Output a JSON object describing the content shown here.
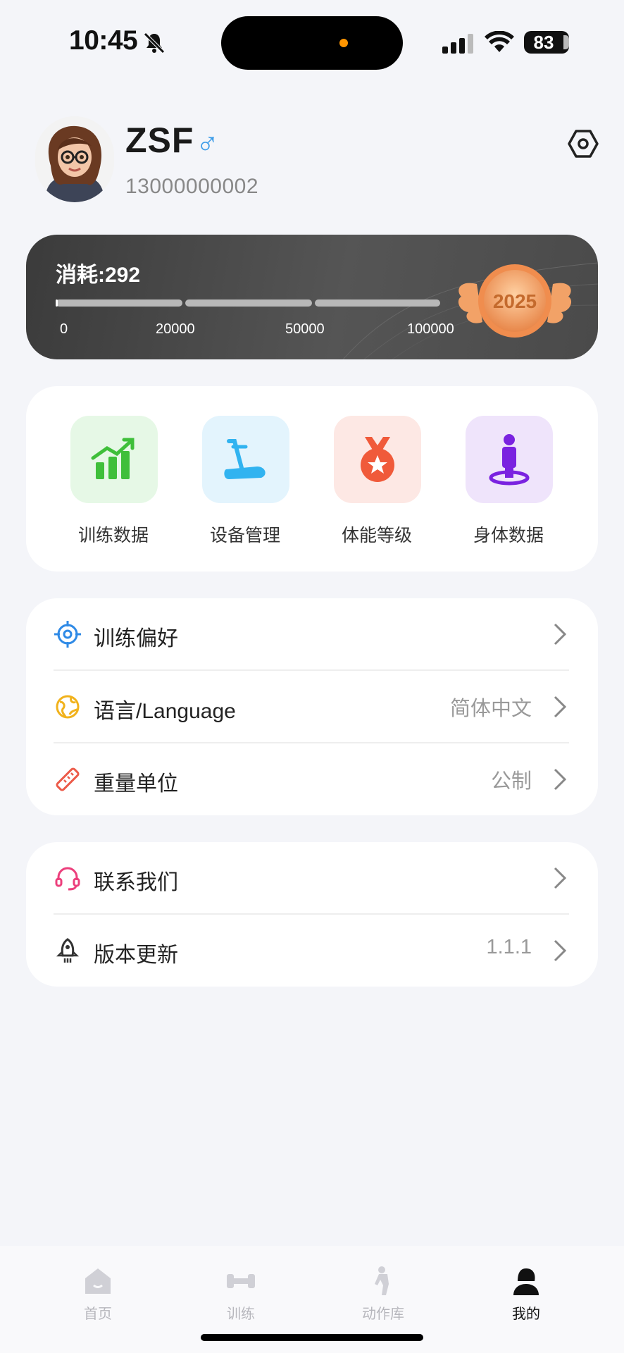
{
  "status_bar": {
    "time": "10:45",
    "battery": "83"
  },
  "profile": {
    "name": "ZSF",
    "gender_symbol": "♂",
    "phone": "13000000002"
  },
  "banner": {
    "consume_label": "消耗:292",
    "progress_value": 292,
    "milestones": [
      "0",
      "20000",
      "50000",
      "100000"
    ],
    "medal_year": "2025"
  },
  "quick_actions": [
    {
      "label": "训练数据",
      "icon": "bar-chart-icon",
      "tile_color": "#e6f8e6",
      "icon_color": "#3fbf3a"
    },
    {
      "label": "设备管理",
      "icon": "treadmill-icon",
      "tile_color": "#e3f4fd",
      "icon_color": "#31b3f0"
    },
    {
      "label": "体能等级",
      "icon": "medal-icon",
      "tile_color": "#fde8e4",
      "icon_color": "#f05a3a"
    },
    {
      "label": "身体数据",
      "icon": "person-icon",
      "tile_color": "#efe4fb",
      "icon_color": "#7a22e0"
    }
  ],
  "settings_list": [
    {
      "label": "训练偏好",
      "value": "",
      "icon": "target-icon",
      "icon_color": "#2f8ae6"
    },
    {
      "label": "语言/Language",
      "value": "简体中文",
      "icon": "globe-icon",
      "icon_color": "#f1b21c"
    },
    {
      "label": "重量单位",
      "value": "公制",
      "icon": "ruler-icon",
      "icon_color": "#ec5a48"
    }
  ],
  "support_list": [
    {
      "label": "联系我们",
      "value": "",
      "icon": "headset-icon",
      "icon_color": "#ec3f7c"
    },
    {
      "label": "版本更新",
      "value": "1.1.1",
      "icon": "rocket-icon",
      "icon_color": "#333333"
    }
  ],
  "tabbar": [
    {
      "label": "首页",
      "icon": "home-icon",
      "active": false
    },
    {
      "label": "训练",
      "icon": "dumbbell-icon",
      "active": false
    },
    {
      "label": "动作库",
      "icon": "stretch-figure-icon",
      "active": false
    },
    {
      "label": "我的",
      "icon": "user-icon",
      "active": true
    }
  ]
}
